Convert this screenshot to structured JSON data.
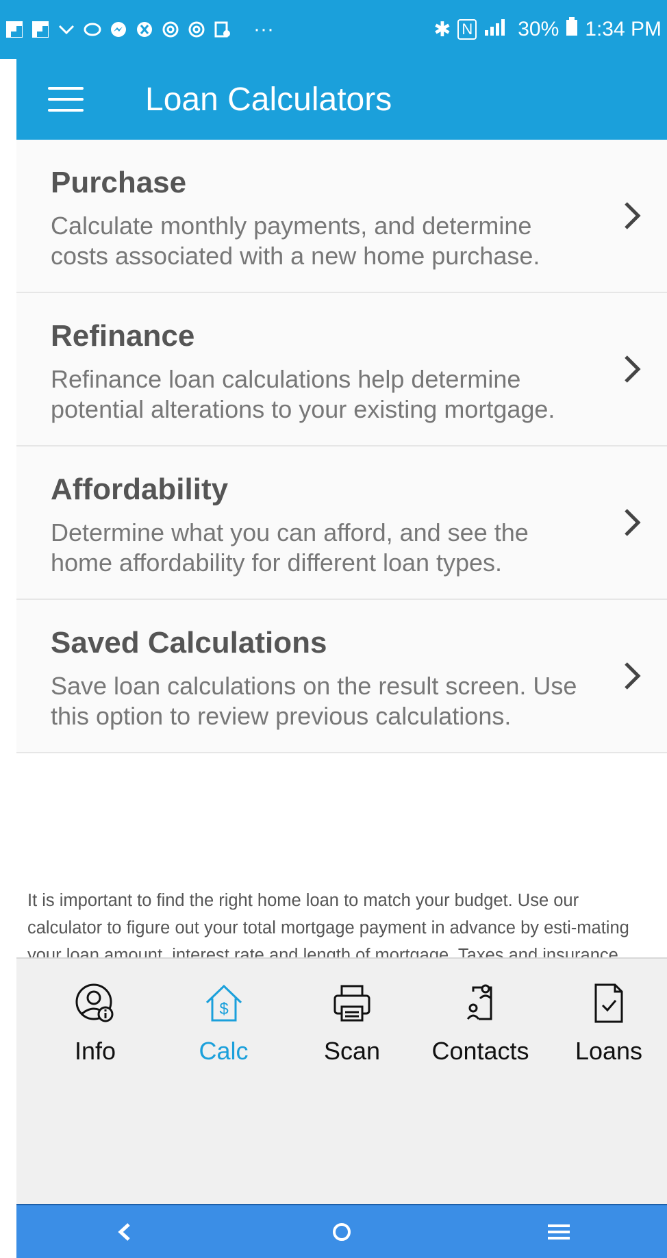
{
  "status": {
    "icons": [
      "flipboard-icon",
      "flipboard-icon",
      "dialer-icon",
      "app-icon",
      "messenger-icon",
      "xbox-icon",
      "at-icon",
      "at-icon",
      "media-icon"
    ],
    "more": "···",
    "battery_percent": "30%",
    "time": "1:34 PM"
  },
  "app_bar": {
    "title": "Loan Calculators"
  },
  "items": [
    {
      "title": "Purchase",
      "description": "Calculate monthly payments, and determine costs associated with a new home purchase."
    },
    {
      "title": "Refinance",
      "description": "Refinance loan calculations help determine potential alterations to your existing mortgage."
    },
    {
      "title": "Affordability",
      "description": "Determine what you can afford, and see the home affordability for different loan types."
    },
    {
      "title": "Saved Calculations",
      "description": "Save loan calculations on the result screen. Use this option to review previous calculations."
    }
  ],
  "disclaimer": "It is important to find the right home loan to match your budget. Use our calculator to figure out your total mortgage payment in advance by esti-mating your loan amount, interest rate and length of mortgage. Taxes and insurance amounts are not required, but are useful in determining your total payment amount. The results displayed are only estimates and cannot be used to determine actual loan costs or be used as a guarantee. Refinancing or taking out a home equity loan or line of credit may increase the total",
  "tabs": [
    {
      "label": "Info",
      "icon": "user-info-icon",
      "active": false
    },
    {
      "label": "Calc",
      "icon": "home-dollar-icon",
      "active": true
    },
    {
      "label": "Scan",
      "icon": "printer-icon",
      "active": false
    },
    {
      "label": "Contacts",
      "icon": "contacts-icon",
      "active": false
    },
    {
      "label": "Loans",
      "icon": "document-check-icon",
      "active": false
    }
  ],
  "colors": {
    "primary": "#1ba0db",
    "nav": "#3b8ee6"
  }
}
